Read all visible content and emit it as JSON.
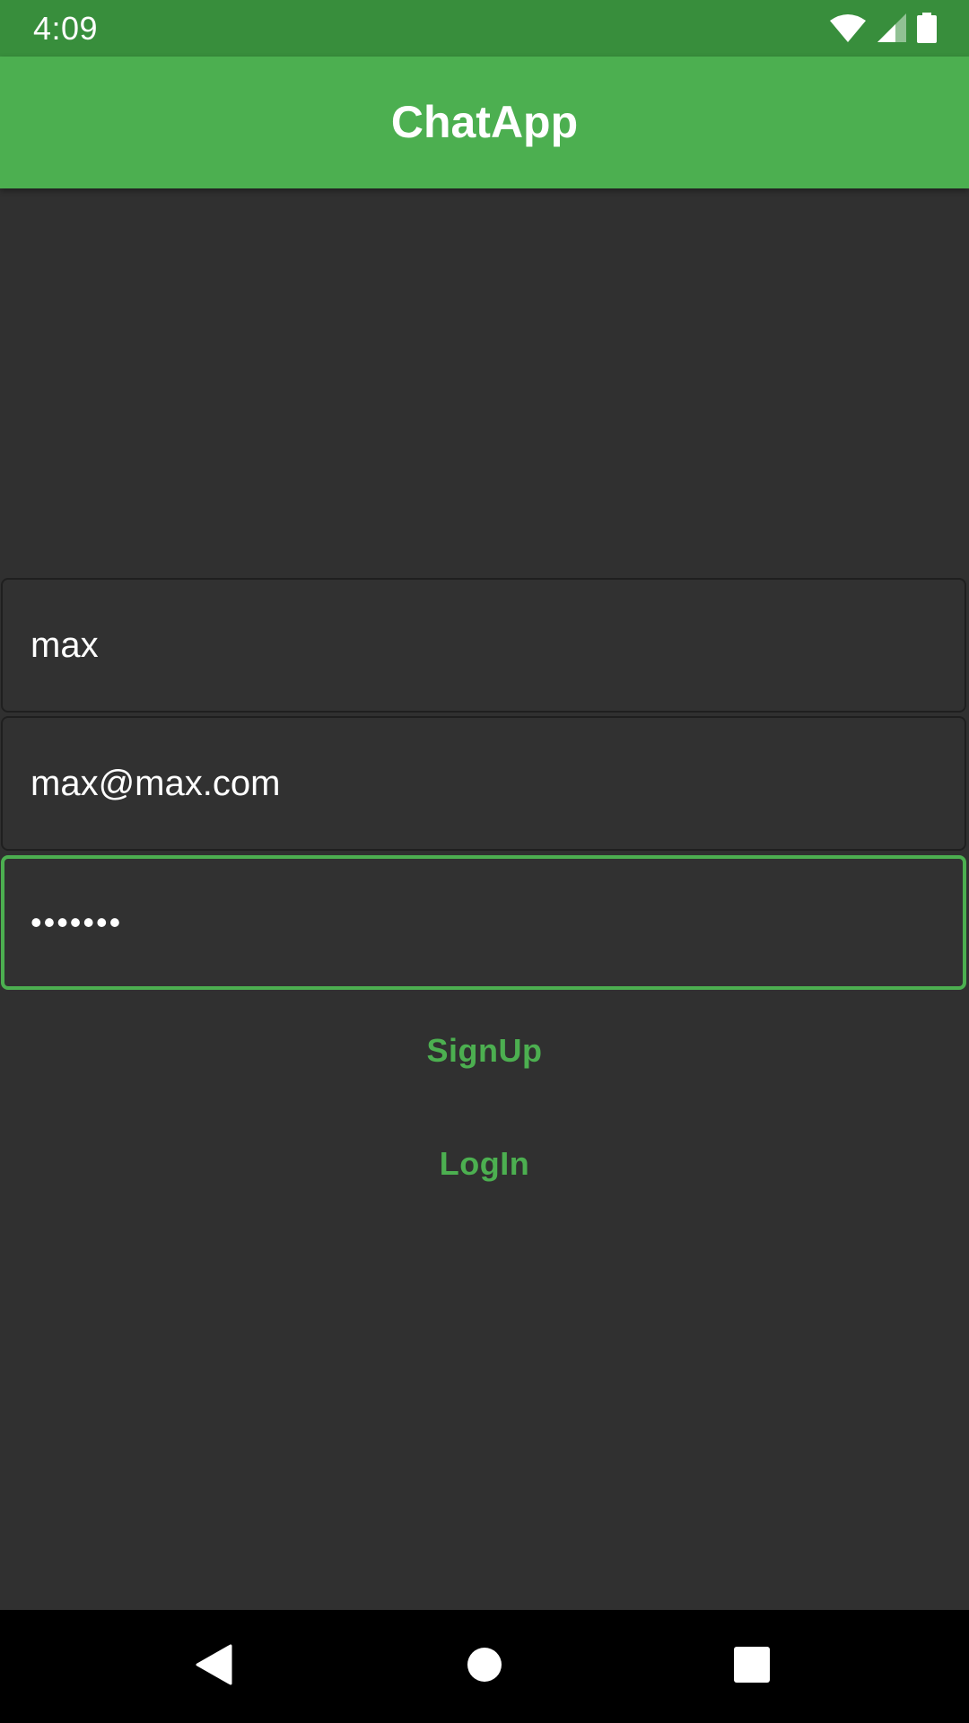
{
  "status_bar": {
    "time": "4:09",
    "icons": [
      "wifi-icon",
      "cell-signal-icon",
      "battery-icon"
    ]
  },
  "app_bar": {
    "title": "ChatApp",
    "color": "#4caf50"
  },
  "form": {
    "username_value": "max",
    "email_value": "max@max.com",
    "password_value": "•••••••",
    "focused_field": "password"
  },
  "actions": {
    "signup_label": "SignUp",
    "login_label": "LogIn",
    "accent_color": "#4caf50"
  },
  "nav_bar": {
    "buttons": [
      "back-icon",
      "home-icon",
      "recents-icon"
    ]
  }
}
